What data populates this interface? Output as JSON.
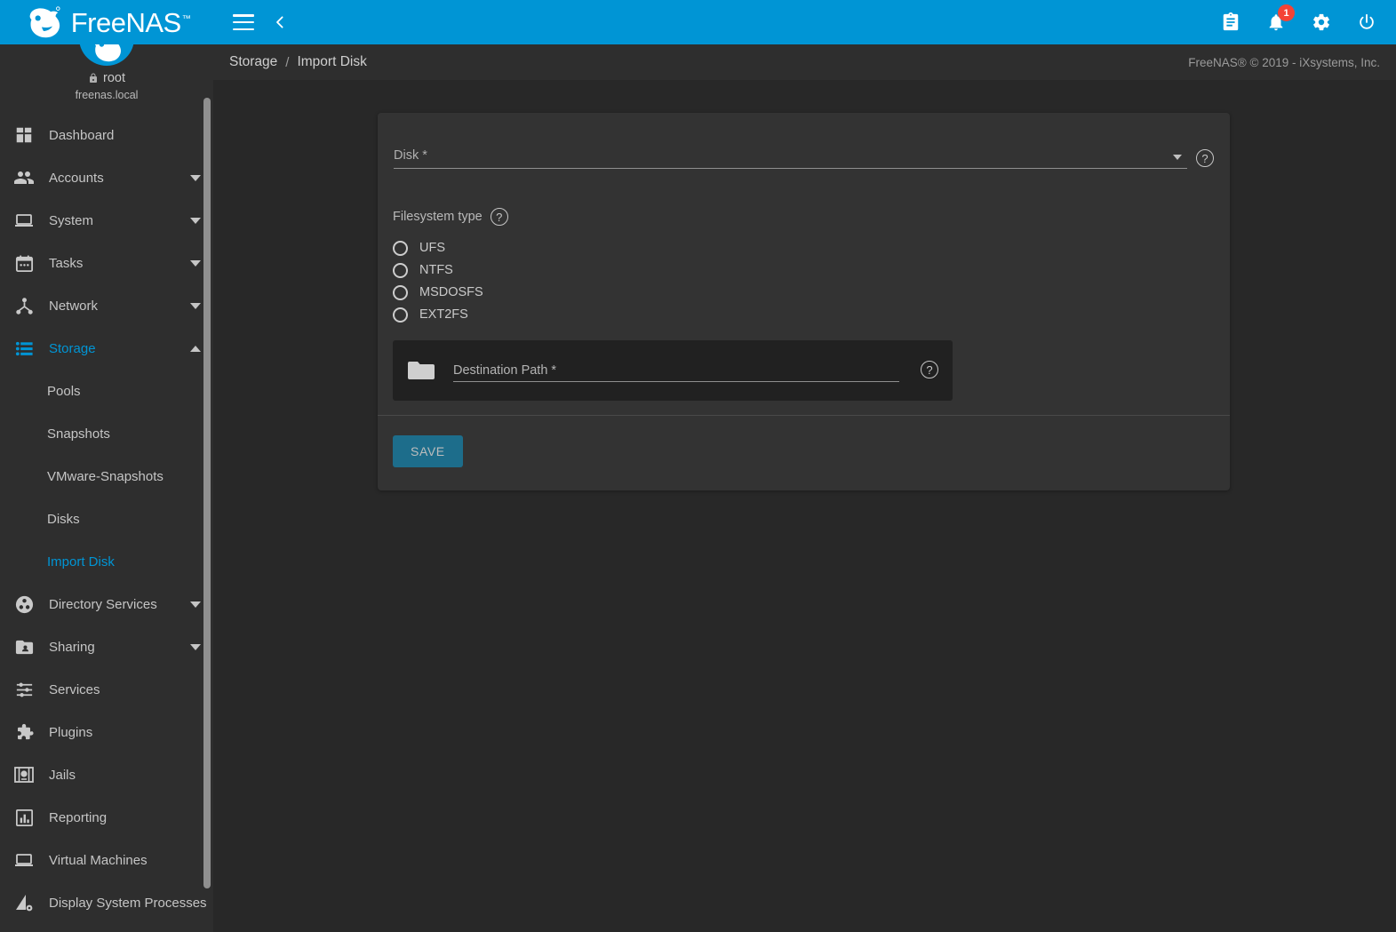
{
  "app": {
    "brand_name": "FreeNAS",
    "brand_tm": "™"
  },
  "topbar": {
    "menu_toggle_label": "menu",
    "back_label": "back",
    "icons": [
      "clipboard-icon",
      "bell-icon",
      "gear-icon",
      "power-icon"
    ],
    "notification_count": "1",
    "accent_color": "#0095d5",
    "badge_color": "#f44336"
  },
  "sidebar": {
    "user": {
      "name": "root",
      "host": "freenas.local",
      "lock_icon": "lock-icon"
    },
    "items": [
      {
        "label": "Dashboard",
        "icon": "dashboard-icon",
        "expandable": false,
        "active": false
      },
      {
        "label": "Accounts",
        "icon": "people-icon",
        "expandable": true,
        "expanded": false,
        "active": false
      },
      {
        "label": "System",
        "icon": "laptop-icon",
        "expandable": true,
        "expanded": false,
        "active": false
      },
      {
        "label": "Tasks",
        "icon": "calendar-icon",
        "expandable": true,
        "expanded": false,
        "active": false
      },
      {
        "label": "Network",
        "icon": "network-icon",
        "expandable": true,
        "expanded": false,
        "active": false
      },
      {
        "label": "Storage",
        "icon": "storage-icon",
        "expandable": true,
        "expanded": true,
        "active": true
      }
    ],
    "storage_children": [
      {
        "label": "Pools",
        "active": false
      },
      {
        "label": "Snapshots",
        "active": false
      },
      {
        "label": "VMware-Snapshots",
        "active": false
      },
      {
        "label": "Disks",
        "active": false
      },
      {
        "label": "Import Disk",
        "active": true
      }
    ],
    "items_after": [
      {
        "label": "Directory Services",
        "icon": "directory-icon",
        "expandable": true,
        "expanded": false,
        "active": false
      },
      {
        "label": "Sharing",
        "icon": "sharing-icon",
        "expandable": true,
        "expanded": false,
        "active": false
      },
      {
        "label": "Services",
        "icon": "services-icon",
        "expandable": false,
        "active": false
      },
      {
        "label": "Plugins",
        "icon": "puzzle-icon",
        "expandable": false,
        "active": false
      },
      {
        "label": "Jails",
        "icon": "jails-icon",
        "expandable": false,
        "active": false
      },
      {
        "label": "Reporting",
        "icon": "chart-icon",
        "expandable": false,
        "active": false
      },
      {
        "label": "Virtual Machines",
        "icon": "monitor-icon",
        "expandable": false,
        "active": false
      },
      {
        "label": "Display System Processes",
        "icon": "processes-icon",
        "expandable": false,
        "active": false
      }
    ],
    "active_color": "#0095d5"
  },
  "breadcrumb": {
    "root": "Storage",
    "separator": "/",
    "current": "Import Disk"
  },
  "footer": {
    "copyright": "FreeNAS® © 2019 - iXsystems, Inc."
  },
  "form": {
    "disk": {
      "label": "Disk *",
      "value": "",
      "help_icon": "help-icon"
    },
    "filesystem_type": {
      "label": "Filesystem type",
      "help_icon": "help-icon",
      "options": [
        {
          "label": "UFS",
          "selected": false
        },
        {
          "label": "NTFS",
          "selected": false
        },
        {
          "label": "MSDOSFS",
          "selected": false
        },
        {
          "label": "EXT2FS",
          "selected": false
        }
      ]
    },
    "destination_path": {
      "placeholder": "Destination Path *",
      "value": "",
      "folder_icon": "folder-icon",
      "help_icon": "help-icon"
    },
    "save_label": "SAVE",
    "save_color": "#1d6d8b"
  }
}
